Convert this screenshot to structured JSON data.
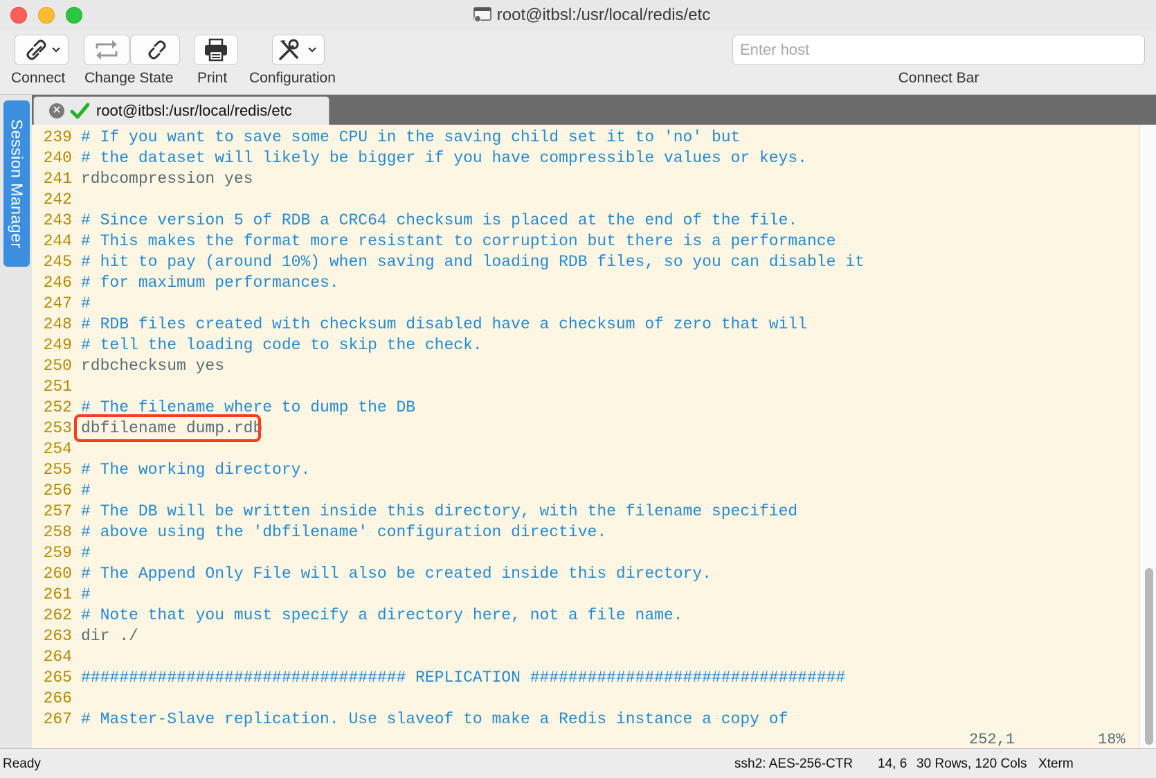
{
  "window": {
    "title": "root@itbsl:/usr/local/redis/etc"
  },
  "toolbar": {
    "connect_label": "Connect",
    "change_state_label": "Change State",
    "print_label": "Print",
    "configuration_label": "Configuration",
    "host_placeholder": "Enter host",
    "host_value": "",
    "connect_bar_label": "Connect Bar"
  },
  "sidebar": {
    "session_manager_label": "Session Manager"
  },
  "tab": {
    "label": "root@itbsl:/usr/local/redis/etc"
  },
  "terminal": {
    "lines": [
      {
        "num": "239",
        "text": "# If you want to save some CPU in the saving child set it to 'no' but",
        "kind": "comment"
      },
      {
        "num": "240",
        "text": "# the dataset will likely be bigger if you have compressible values or keys.",
        "kind": "comment"
      },
      {
        "num": "241",
        "text": "rdbcompression yes",
        "kind": "code"
      },
      {
        "num": "242",
        "text": "",
        "kind": "code"
      },
      {
        "num": "243",
        "text": "# Since version 5 of RDB a CRC64 checksum is placed at the end of the file.",
        "kind": "comment"
      },
      {
        "num": "244",
        "text": "# This makes the format more resistant to corruption but there is a performance",
        "kind": "comment"
      },
      {
        "num": "245",
        "text": "# hit to pay (around 10%) when saving and loading RDB files, so you can disable it",
        "kind": "comment"
      },
      {
        "num": "246",
        "text": "# for maximum performances.",
        "kind": "comment"
      },
      {
        "num": "247",
        "text": "#",
        "kind": "comment"
      },
      {
        "num": "248",
        "text": "# RDB files created with checksum disabled have a checksum of zero that will",
        "kind": "comment"
      },
      {
        "num": "249",
        "text": "# tell the loading code to skip the check.",
        "kind": "comment"
      },
      {
        "num": "250",
        "text": "rdbchecksum yes",
        "kind": "code"
      },
      {
        "num": "251",
        "text": "",
        "kind": "code"
      },
      {
        "num": "252",
        "text": "# The filename where to dump the DB",
        "kind": "comment"
      },
      {
        "num": "253",
        "text": "dbfilename dump.rdb",
        "kind": "code"
      },
      {
        "num": "254",
        "text": "",
        "kind": "code"
      },
      {
        "num": "255",
        "text": "# The working directory.",
        "kind": "comment"
      },
      {
        "num": "256",
        "text": "#",
        "kind": "comment"
      },
      {
        "num": "257",
        "text": "# The DB will be written inside this directory, with the filename specified",
        "kind": "comment"
      },
      {
        "num": "258",
        "text": "# above using the 'dbfilename' configuration directive.",
        "kind": "comment"
      },
      {
        "num": "259",
        "text": "#",
        "kind": "comment"
      },
      {
        "num": "260",
        "text": "# The Append Only File will also be created inside this directory.",
        "kind": "comment"
      },
      {
        "num": "261",
        "text": "#",
        "kind": "comment"
      },
      {
        "num": "262",
        "text": "# Note that you must specify a directory here, not a file name.",
        "kind": "comment"
      },
      {
        "num": "263",
        "text": "dir ./",
        "kind": "code"
      },
      {
        "num": "264",
        "text": "",
        "kind": "code"
      },
      {
        "num": "265",
        "text": "################################## REPLICATION #################################",
        "kind": "comment"
      },
      {
        "num": "266",
        "text": "",
        "kind": "code"
      },
      {
        "num": "267",
        "text": "# Master-Slave replication. Use slaveof to make a Redis instance a copy of",
        "kind": "comment"
      }
    ],
    "cursor_position": "252,1",
    "scroll_percent": "18%",
    "scroll_fraction": 0.18
  },
  "status": {
    "ready": "Ready",
    "cipher": "ssh2: AES-256-CTR",
    "cursor": "14, 6",
    "size": "30 Rows, 120 Cols",
    "emulation": "Xterm"
  }
}
